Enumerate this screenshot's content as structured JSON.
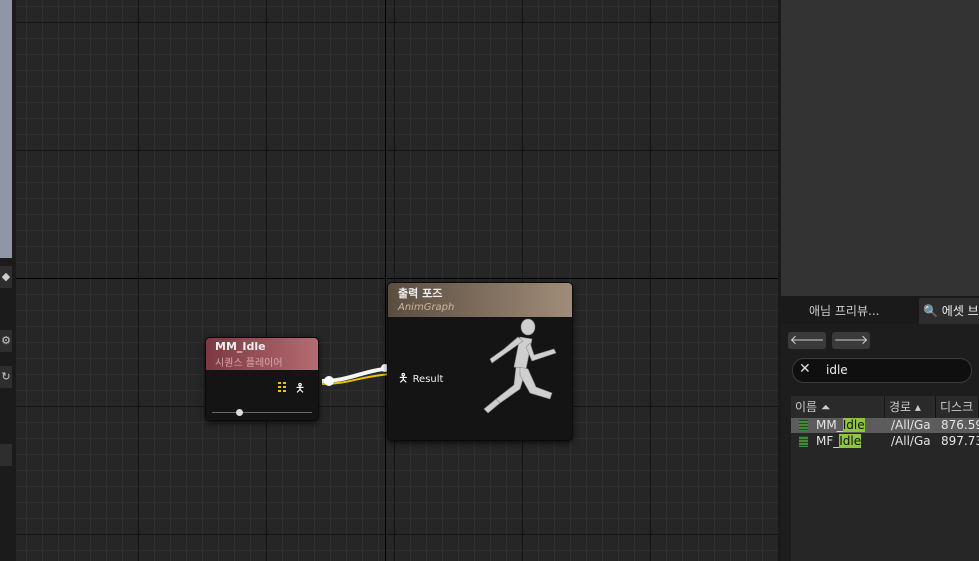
{
  "graph": {
    "sequence_node": {
      "title": "MM_Idle",
      "subtitle": "시퀀스 플레이어"
    },
    "output_node": {
      "title": "출력 포즈",
      "subtitle": "AnimGraph",
      "result_pin": "Result"
    }
  },
  "panel": {
    "tabs": [
      {
        "label": "애님 프리뷰..."
      },
      {
        "label": "에셋 브"
      }
    ],
    "search": {
      "value": "idle"
    },
    "columns": {
      "name": "이름",
      "path": "경로",
      "disk": "디스크"
    },
    "assets": [
      {
        "name_prefix": "MM_",
        "name_highlight": "Idle",
        "path": "/All/Ga",
        "size": "876.59"
      },
      {
        "name_prefix": "MF_",
        "name_highlight": "Idle",
        "path": "/All/Ga",
        "size": "897.73"
      }
    ]
  }
}
